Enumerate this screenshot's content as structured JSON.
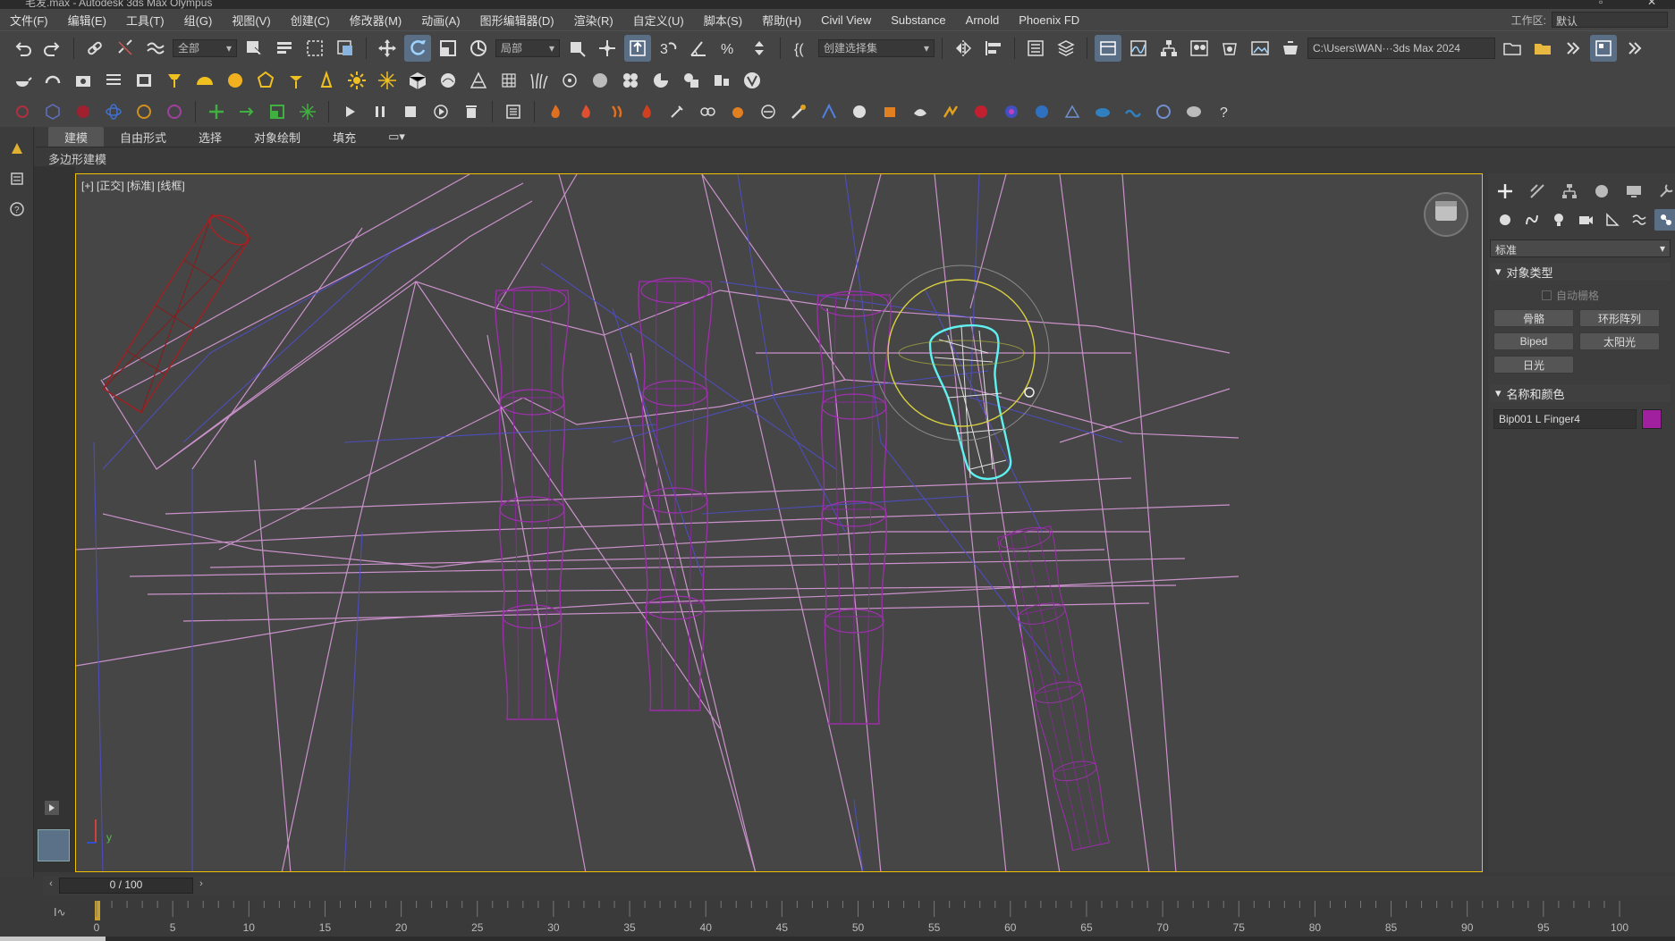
{
  "window": {
    "title": "毛发.max - Autodesk 3ds Max Olympus"
  },
  "menu": [
    "文件(F)",
    "编辑(E)",
    "工具(T)",
    "组(G)",
    "视图(V)",
    "创建(C)",
    "修改器(M)",
    "动画(A)",
    "图形编辑器(D)",
    "渲染(R)",
    "自定义(U)",
    "脚本(S)",
    "帮助(H)",
    "Civil View",
    "Substance",
    "Arnold",
    "Phoenix FD"
  ],
  "workspace": {
    "label": "工作区:",
    "value": "默认"
  },
  "toolbar1": {
    "filter_dropdown": "全部",
    "coord_dropdown": "局部",
    "selection_set": "创建选择集",
    "project_path": "C:\\Users\\WAN···3ds Max 2024"
  },
  "ribbon": {
    "tabs": [
      "建模",
      "自由形式",
      "选择",
      "对象绘制",
      "填充"
    ],
    "sub_label": "多边形建模"
  },
  "viewport": {
    "label": "[+] [正交] [标准] [线框]"
  },
  "command_panel": {
    "category": "标准",
    "object_type_title": "对象类型",
    "autogrid_label": "自动栅格",
    "buttons": [
      "骨骼",
      "环形阵列",
      "Biped",
      "太阳光",
      "日光"
    ],
    "name_color_title": "名称和颜色",
    "object_name": "Bip001 L Finger4",
    "object_color": "#a020a0"
  },
  "timeline": {
    "frame_display": "0 / 100",
    "ticks": [
      "0",
      "5",
      "10",
      "15",
      "20",
      "25",
      "30",
      "35",
      "40",
      "45",
      "50",
      "55",
      "60",
      "65",
      "70",
      "75",
      "80",
      "85",
      "90",
      "95",
      "100"
    ]
  },
  "colors": {
    "accent": "#5a6f86",
    "viewport_border": "#f2c200",
    "selected_object": "#5ff0f0"
  }
}
